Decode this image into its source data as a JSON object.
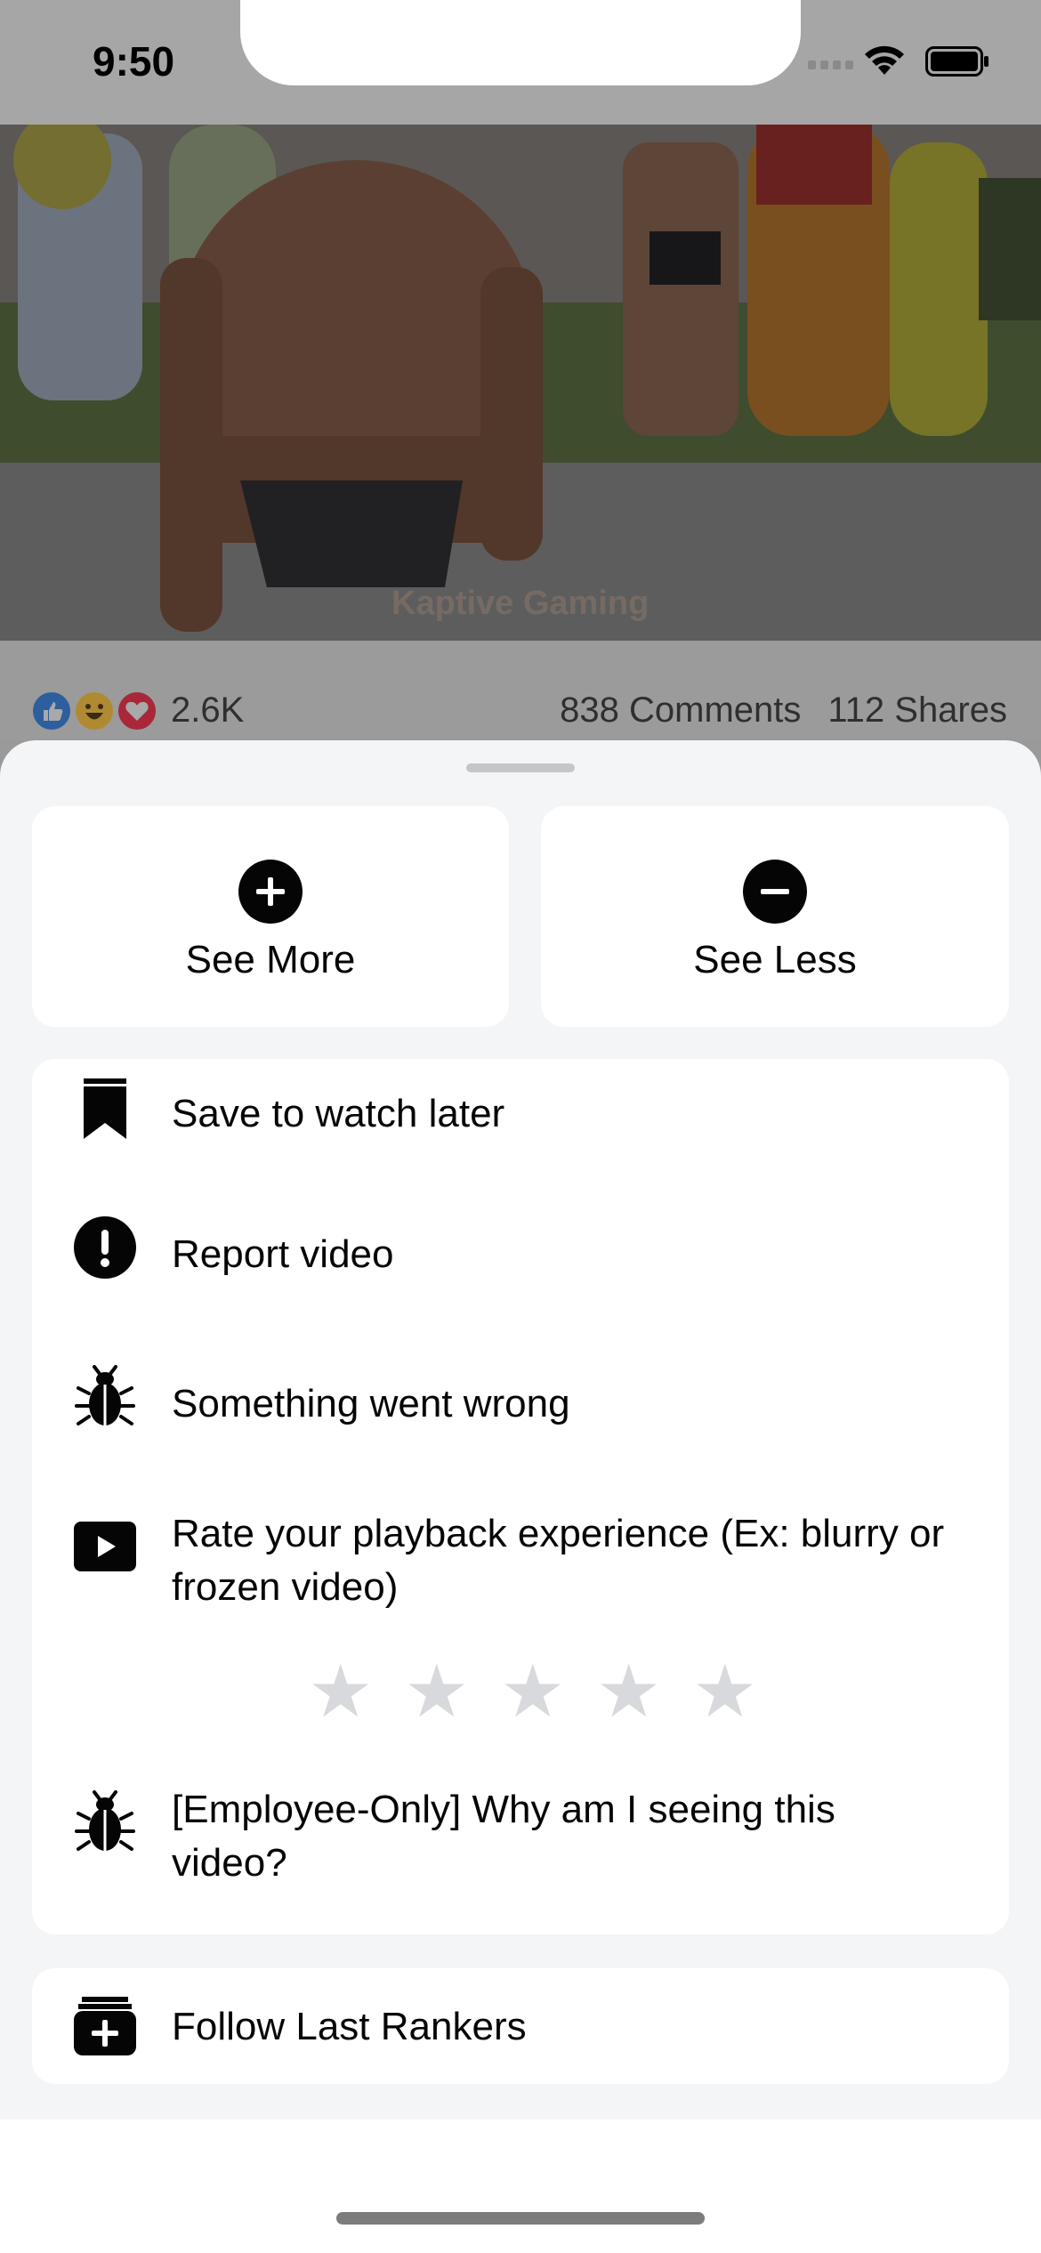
{
  "status_bar": {
    "time": "9:50"
  },
  "video": {
    "watermark": "Kaptive Gaming"
  },
  "reactions": {
    "count": "2.6K",
    "comments": "838 Comments",
    "shares": "112 Shares",
    "icons": [
      "like-icon",
      "haha-icon",
      "love-icon"
    ]
  },
  "sheet": {
    "see_more_label": "See More",
    "see_less_label": "See Less",
    "items": [
      {
        "label": "Save to watch later",
        "icon": "bookmark-icon"
      },
      {
        "label": "Report video",
        "icon": "exclamation-icon"
      },
      {
        "label": "Something went wrong",
        "icon": "bug-icon"
      },
      {
        "label": "Rate your playback experience (Ex: blurry or frozen video)",
        "icon": "play-icon"
      },
      {
        "label": "[Employee-Only] Why am I seeing this video?",
        "icon": "bug-icon"
      }
    ],
    "rating": {
      "stars": 5,
      "selected": 0
    },
    "follow_label": "Follow Last Rankers"
  },
  "colors": {
    "text": "#050505",
    "star_empty": "#d8d9dd",
    "like": "#1877f2",
    "love": "#e4324e",
    "haha": "#f7b125"
  }
}
